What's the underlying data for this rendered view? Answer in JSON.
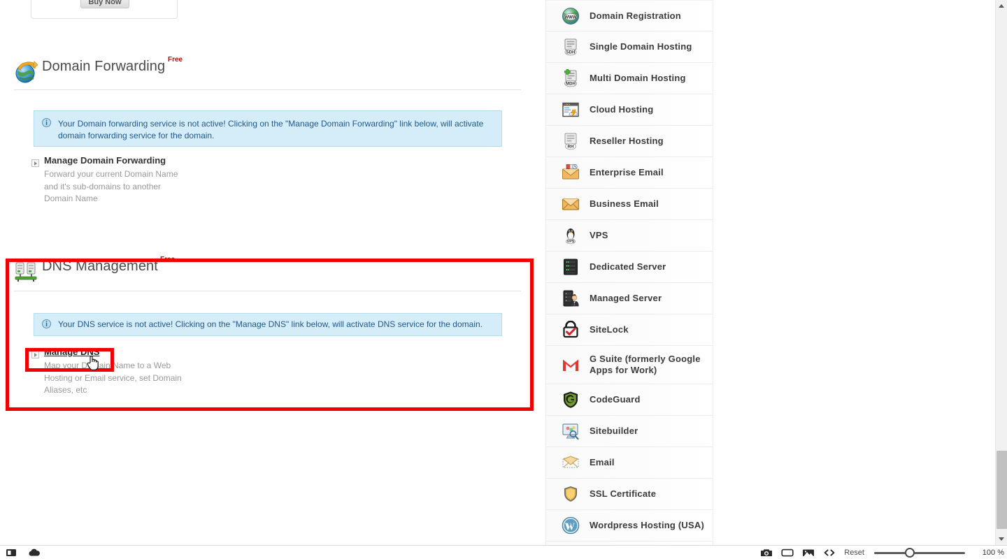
{
  "top_card": {
    "button_label": "Buy Now"
  },
  "sections": [
    {
      "id": "domain-forwarding",
      "title": "Domain Forwarding",
      "badge": "Free",
      "icon": "globe-arrow-icon",
      "notice": "Your Domain forwarding service is not active! Clicking on the \"Manage Domain Forwarding\" link below, will activate domain forwarding service for the domain.",
      "link_label": "Manage Domain Forwarding",
      "link_desc": "Forward your current Domain Name and it's sub-domains to another Domain Name"
    },
    {
      "id": "dns-management",
      "title": "DNS Management",
      "badge": "Free",
      "icon": "dns-servers-icon",
      "notice": "Your DNS service is not active! Clicking on the \"Manage DNS\" link below, will activate DNS service for the domain.",
      "link_label": "Manage DNS",
      "link_desc": "Map your Domain Name to a Web Hosting or Email service, set Domain Aliases, etc"
    }
  ],
  "highlight": {
    "color": "#ee0000"
  },
  "sidebar": {
    "items": [
      {
        "label": "Domain Registration",
        "icon": "globe-www-icon"
      },
      {
        "label": "Single Domain Hosting",
        "icon": "server-sdh-icon"
      },
      {
        "label": "Multi Domain Hosting",
        "icon": "server-mdh-icon"
      },
      {
        "label": "Cloud Hosting",
        "icon": "cloud-hosting-icon"
      },
      {
        "label": "Reseller Hosting",
        "icon": "server-rh-icon"
      },
      {
        "label": "Enterprise Email",
        "icon": "enterprise-email-icon"
      },
      {
        "label": "Business Email",
        "icon": "envelope-icon"
      },
      {
        "label": "VPS",
        "icon": "vps-penguin-icon"
      },
      {
        "label": "Dedicated Server",
        "icon": "dedicated-server-icon"
      },
      {
        "label": "Managed Server",
        "icon": "managed-server-icon"
      },
      {
        "label": "SiteLock",
        "icon": "sitelock-icon"
      },
      {
        "label": "G Suite (formerly Google Apps for Work)",
        "icon": "gmail-m-icon"
      },
      {
        "label": "CodeGuard",
        "icon": "codeguard-shield-icon"
      },
      {
        "label": "Sitebuilder",
        "icon": "sitebuilder-monitor-icon"
      },
      {
        "label": "Email",
        "icon": "email-envelope-icon"
      },
      {
        "label": "SSL Certificate",
        "icon": "ssl-shield-icon"
      },
      {
        "label": "Wordpress Hosting (USA)",
        "icon": "wordpress-icon"
      }
    ]
  },
  "bottombar": {
    "left_icons": [
      {
        "name": "contrast-icon"
      },
      {
        "name": "cloud-icon"
      }
    ],
    "right_icons": [
      {
        "name": "camera-icon"
      },
      {
        "name": "rectangle-icon"
      },
      {
        "name": "image-icon"
      },
      {
        "name": "code-icon"
      }
    ],
    "reset_label": "Reset",
    "zoom_value": "100 %"
  },
  "scrollbar": {
    "position": "near-bottom"
  }
}
